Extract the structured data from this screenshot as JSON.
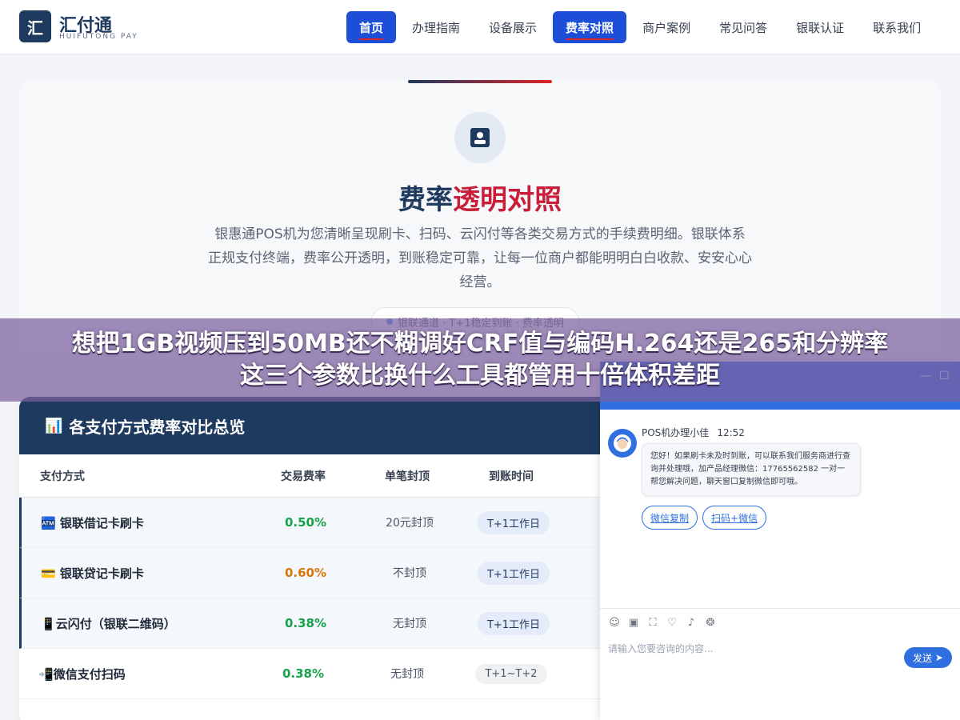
{
  "header": {
    "logo_mark": "汇",
    "logo_name": "汇付通",
    "logo_sub": "HUIFUTONG PAY",
    "nav": [
      {
        "label": "首页",
        "active": true
      },
      {
        "label": "办理指南",
        "active": false
      },
      {
        "label": "设备展示",
        "active": false
      },
      {
        "label": "费率对照",
        "active": true
      },
      {
        "label": "商户案例",
        "active": false
      },
      {
        "label": "常见问答",
        "active": false
      },
      {
        "label": "银联认证",
        "active": false
      },
      {
        "label": "联系我们",
        "active": false
      }
    ]
  },
  "intro": {
    "icon": "id-card-icon",
    "title_main": "费率",
    "title_accent": "透明对照",
    "description": "银惠通POS机为您清晰呈现刷卡、扫码、云闪付等各类交易方式的手续费明细。银联体系正规支付终端，费率公开透明，到账稳定可靠，让每一位商户都能明明白白收款、安安心心经营。",
    "badge": "银联通道 · T+1稳定到账 · 费率透明"
  },
  "table": {
    "title_icon": "📊",
    "title": "各支付方式费率对比总览",
    "columns": [
      "支付方式",
      "交易费率",
      "单笔封顶",
      "到账时间"
    ],
    "rows": [
      {
        "icon": "🏧",
        "name": "银联借记卡刷卡",
        "rate": "0.50%",
        "rate_color": "green",
        "cap": "20元封顶",
        "settle": "T+1工作日"
      },
      {
        "icon": "💳",
        "name": "银联贷记卡刷卡",
        "rate": "0.60%",
        "rate_color": "orange",
        "cap": "不封顶",
        "settle": "T+1工作日"
      },
      {
        "icon": "📱",
        "name": "云闪付（银联二维码）",
        "rate": "0.38%",
        "rate_color": "green",
        "cap": "无封顶",
        "settle": "T+1工作日"
      },
      {
        "icon": "📲",
        "name": "微信支付扫码",
        "rate": "0.38%",
        "rate_color": "green",
        "cap": "无封顶",
        "settle": "T+1~T+2"
      }
    ]
  },
  "chat": {
    "sender": "POS机办理小佳",
    "time": "12:52",
    "message": "您好！如果刷卡未及时到账，可以联系我们服务商进行查询并处理哦，加产品经理微信：17765562582 一对一帮您解决问题，聊天窗口复制微信即可哦。",
    "actions": [
      "微信复制",
      "扫码+微信"
    ],
    "input_placeholder": "请输入您要咨询的内容...",
    "send_label": "发送",
    "minimize": "—",
    "maximize": "☐"
  },
  "banner": {
    "line1": "想把1GB视频压到50MB还不糊调好CRF值与编码H.264还是265和分辨率",
    "line2": "这三个参数比换什么工具都管用十倍体积差距"
  },
  "colors": {
    "brand": "#1e3a5f",
    "accent": "#c81e3a",
    "nav_active": "#1d4ed8",
    "chat": "#2f6fe0"
  }
}
